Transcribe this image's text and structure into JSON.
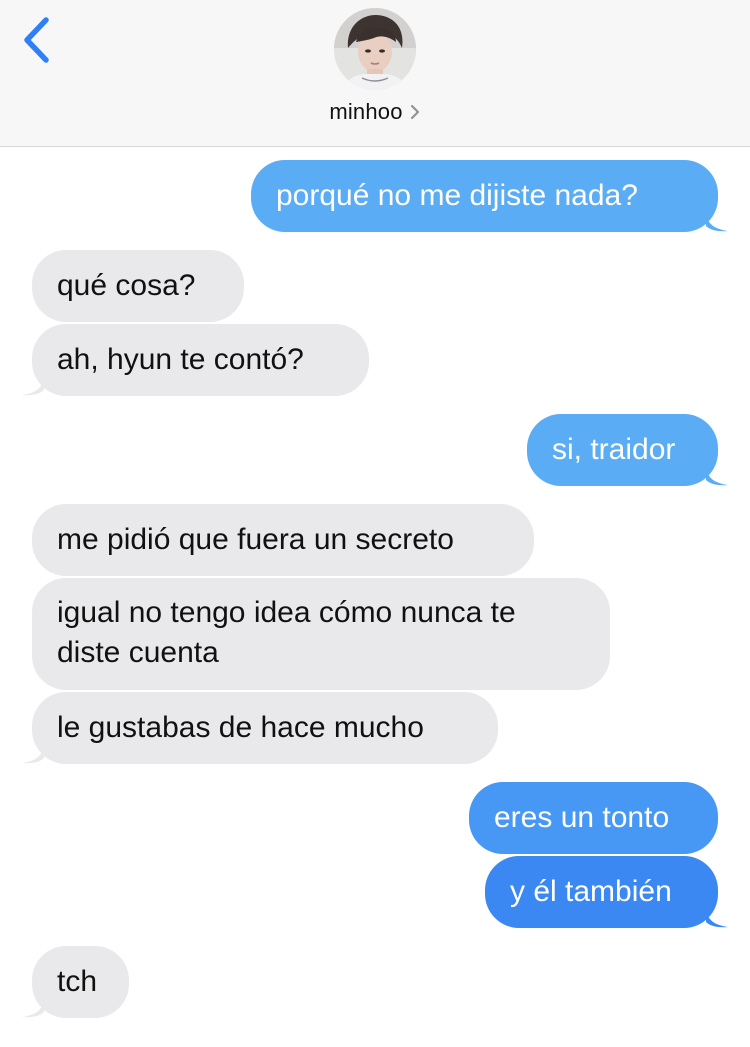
{
  "header": {
    "contact_name": "minhoo",
    "back_icon": "chevron-left-icon",
    "chevron_icon": "chevron-right-icon",
    "accent_color": "#2f7ff6"
  },
  "messages": [
    {
      "direction": "sent",
      "text": "porqué no me dijiste nada?"
    },
    {
      "direction": "received",
      "text": "qué cosa?"
    },
    {
      "direction": "received",
      "text": "ah, hyun te contó?"
    },
    {
      "direction": "sent",
      "text": "si, traidor"
    },
    {
      "direction": "received",
      "text": "me pidió que fuera un secreto"
    },
    {
      "direction": "received",
      "text": "igual no tengo idea cómo nunca te diste cuenta"
    },
    {
      "direction": "received",
      "text": "le gustabas de hace mucho"
    },
    {
      "direction": "sent",
      "text": "eres un tonto"
    },
    {
      "direction": "sent",
      "text": "y él también"
    },
    {
      "direction": "received",
      "text": "tch"
    }
  ],
  "colors": {
    "received_bubble": "#e9e9eb",
    "sent_bubble_light": "#5aacf5",
    "sent_bubble_mid": "#4698f4",
    "sent_bubble_dark": "#3b88f3"
  }
}
